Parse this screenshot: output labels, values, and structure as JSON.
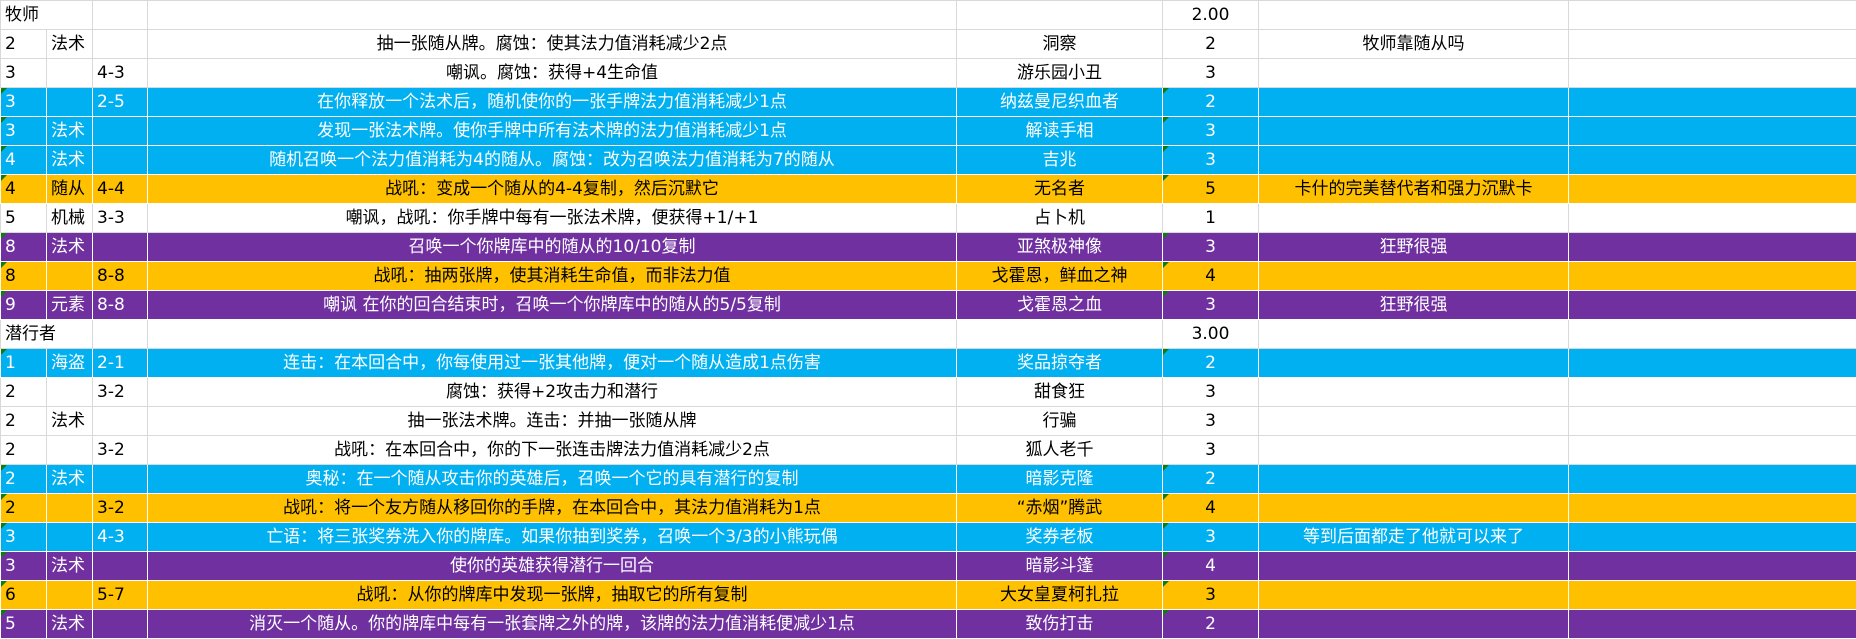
{
  "colors": {
    "cyan": "#00b0f0",
    "orange": "#ffc000",
    "purple": "#7030a0",
    "white": "#ffffff",
    "comment_marker": "#107c10"
  },
  "sections": [
    {
      "label": "牧师",
      "score": "2.00",
      "rows": [
        {
          "color": "white",
          "cost": "2",
          "type": "法术",
          "stats": "",
          "desc": "抽一张随从牌。腐蚀：使其法力值消耗减少2点",
          "name": "洞察",
          "score": "2",
          "note": "牧师靠随从吗"
        },
        {
          "color": "white",
          "cost": "3",
          "type": "",
          "stats": "4-3",
          "desc": "嘲讽。腐蚀：获得+4生命值",
          "name": "游乐园小丑",
          "score": "3",
          "note": ""
        },
        {
          "color": "cyan",
          "cost": "3",
          "type": "",
          "stats": "2-5",
          "desc": "在你释放一个法术后，随机使你的一张手牌法力值消耗减少1点",
          "name": "纳兹曼尼织血者",
          "score": "2",
          "note": ""
        },
        {
          "color": "cyan",
          "cost": "3",
          "type": "法术",
          "stats": "",
          "desc": "发现一张法术牌。使你手牌中所有法术牌的法力值消耗减少1点",
          "name": "解读手相",
          "score": "3",
          "note": ""
        },
        {
          "color": "cyan",
          "cost": "4",
          "type": "法术",
          "stats": "",
          "desc": "随机召唤一个法力值消耗为4的随从。腐蚀：改为召唤法力值消耗为7的随从",
          "name": "吉兆",
          "score": "3",
          "note": ""
        },
        {
          "color": "orange",
          "cost": "4",
          "type": "随从",
          "stats": "4-4",
          "desc": "战吼：变成一个随从的4-4复制，然后沉默它",
          "name": "无名者",
          "score": "5",
          "note": "卡什的完美替代者和强力沉默卡"
        },
        {
          "color": "white",
          "cost": "5",
          "type": "机械",
          "stats": "3-3",
          "desc": "嘲讽，战吼：你手牌中每有一张法术牌，便获得+1/+1",
          "name": "占卜机",
          "score": "1",
          "note": ""
        },
        {
          "color": "purple",
          "cost": "8",
          "type": "法术",
          "stats": "",
          "desc": "召唤一个你牌库中的随从的10/10复制",
          "name": "亚煞极神像",
          "score": "3",
          "note": "狂野很强"
        },
        {
          "color": "orange",
          "cost": "8",
          "type": "",
          "stats": "8-8",
          "desc": "战吼：抽两张牌，使其消耗生命值，而非法力值",
          "name": "戈霍恩，鲜血之神",
          "score": "4",
          "note": ""
        },
        {
          "color": "purple",
          "cost": "9",
          "type": "元素",
          "stats": "8-8",
          "desc": "嘲讽 在你的回合结束时，召唤一个你牌库中的随从的5/5复制",
          "name": "戈霍恩之血",
          "score": "3",
          "note": "狂野很强"
        }
      ]
    },
    {
      "label": "潜行者",
      "score": "3.00",
      "rows": [
        {
          "color": "cyan",
          "cost": "1",
          "type": "海盗",
          "stats": "2-1",
          "desc": "连击：在本回合中，你每使用过一张其他牌，便对一个随从造成1点伤害",
          "name": "奖品掠夺者",
          "score": "2",
          "note": ""
        },
        {
          "color": "white",
          "cost": "2",
          "type": "",
          "stats": "3-2",
          "desc": "腐蚀：获得+2攻击力和潜行",
          "name": "甜食狂",
          "score": "3",
          "note": ""
        },
        {
          "color": "white",
          "cost": "2",
          "type": "法术",
          "stats": "",
          "desc": "抽一张法术牌。连击：并抽一张随从牌",
          "name": "行骗",
          "score": "3",
          "note": ""
        },
        {
          "color": "white",
          "cost": "2",
          "type": "",
          "stats": "3-2",
          "desc": "战吼：在本回合中，你的下一张连击牌法力值消耗减少2点",
          "name": "狐人老千",
          "score": "3",
          "note": ""
        },
        {
          "color": "cyan",
          "cost": "2",
          "type": "法术",
          "stats": "",
          "desc": "奥秘：在一个随从攻击你的英雄后，召唤一个它的具有潜行的复制",
          "name": "暗影克隆",
          "score": "2",
          "note": ""
        },
        {
          "color": "orange",
          "cost": "2",
          "type": "",
          "stats": "3-2",
          "desc": "战吼：将一个友方随从移回你的手牌，在本回合中，其法力值消耗为1点",
          "name": "“赤烟”腾武",
          "score": "4",
          "note": ""
        },
        {
          "color": "cyan",
          "cost": "3",
          "type": "",
          "stats": "4-3",
          "desc": "亡语：将三张奖券洗入你的牌库。如果你抽到奖券，召唤一个3/3的小熊玩偶",
          "name": "奖券老板",
          "score": "3",
          "note": "等到后面都走了他就可以来了"
        },
        {
          "color": "purple",
          "cost": "3",
          "type": "法术",
          "stats": "",
          "desc": "使你的英雄获得潜行一回合",
          "name": "暗影斗篷",
          "score": "4",
          "note": ""
        },
        {
          "color": "orange",
          "cost": "6",
          "type": "",
          "stats": "5-7",
          "desc": "战吼：从你的牌库中发现一张牌，抽取它的所有复制",
          "name": "大女皇夏柯扎拉",
          "score": "3",
          "note": ""
        },
        {
          "color": "purple",
          "cost": "5",
          "type": "法术",
          "stats": "",
          "desc": "消灭一个随从。你的牌库中每有一张套牌之外的牌，该牌的法力值消耗便减少1点",
          "name": "致伤打击",
          "score": "2",
          "note": ""
        }
      ]
    }
  ]
}
